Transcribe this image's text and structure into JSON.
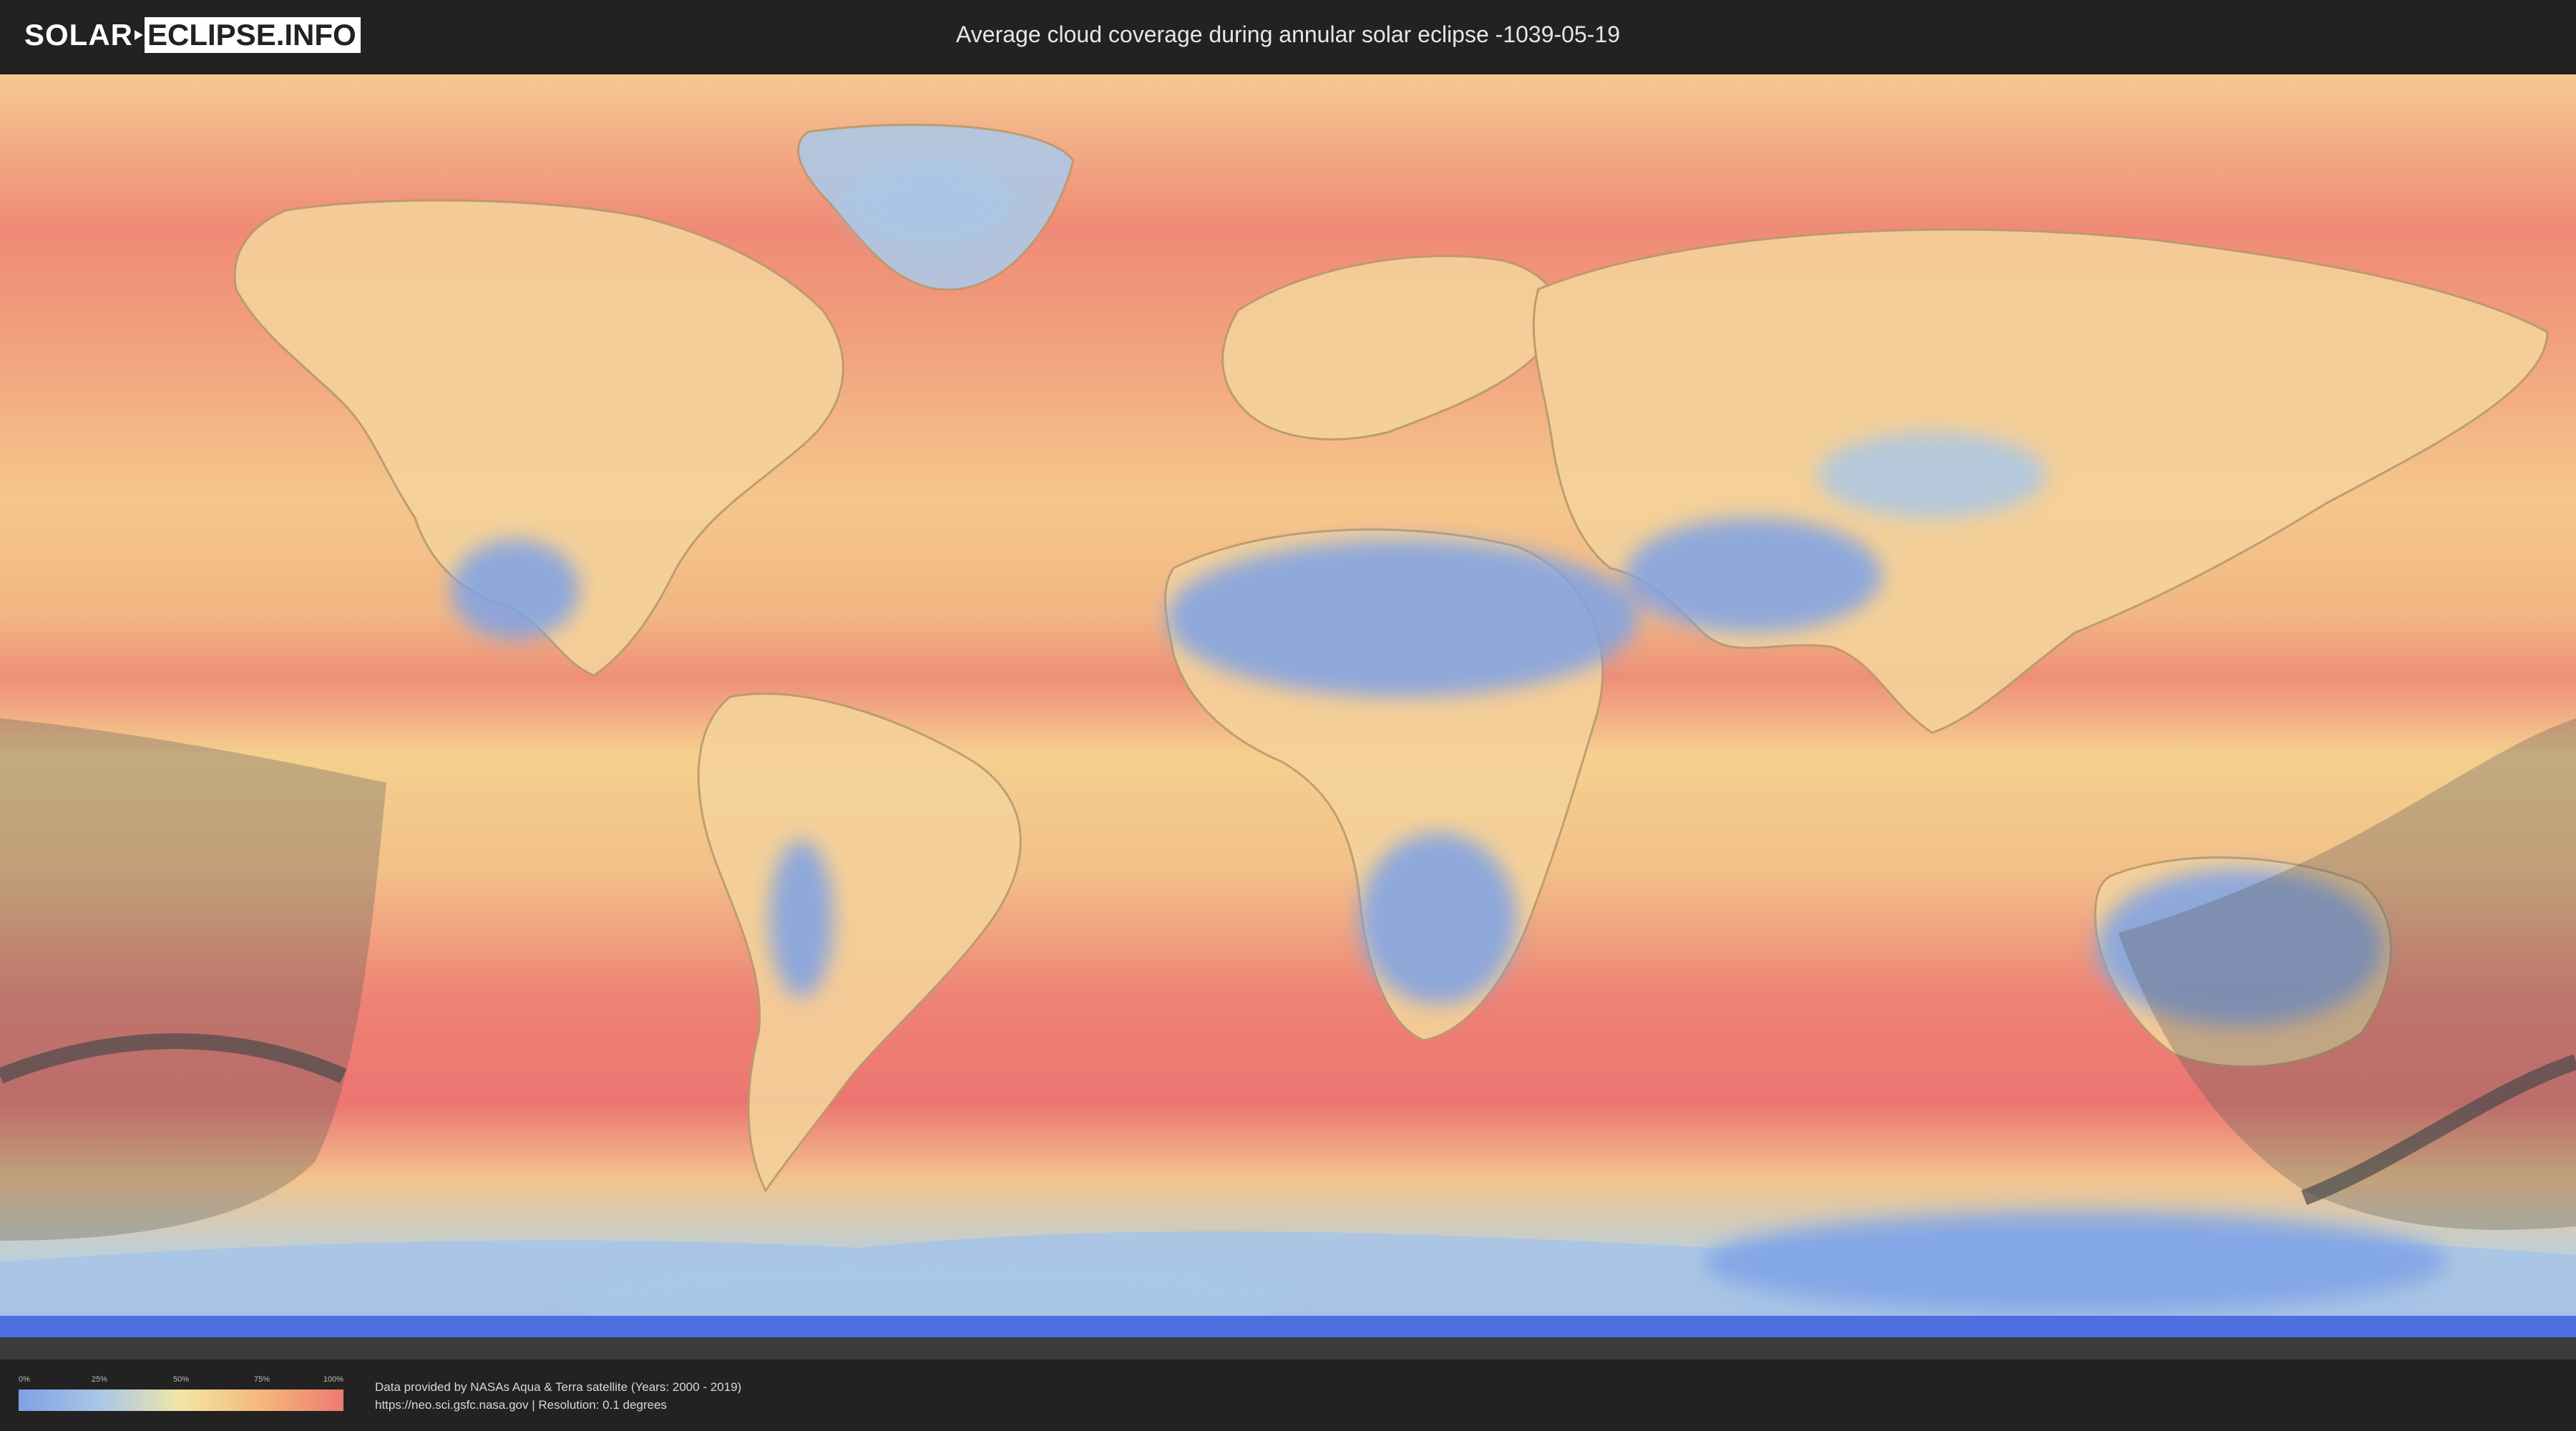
{
  "header": {
    "logo_solar": "SOLAR",
    "logo_eclipse": "ECLIPSE.INFO",
    "title": "Average cloud coverage during annular solar eclipse -1039-05-19"
  },
  "map": {
    "layers": [
      "cloud-coverage-raster",
      "country-borders",
      "eclipse-penumbra-region-west",
      "eclipse-penumbra-region-east",
      "eclipse-central-path"
    ],
    "colors": {
      "clear": "#7fa0e6",
      "low": "#a9c7e6",
      "mid": "#f2e6a6",
      "high": "#f5b77a",
      "overcast": "#ee7a72",
      "eclipse_shadow": "#5a5a5a",
      "polar": "#4e6fe0"
    }
  },
  "legend": {
    "ticks": [
      "0%",
      "25%",
      "50%",
      "75%",
      "100%"
    ]
  },
  "footer": {
    "credit_line1": "Data provided by NASAs Aqua & Terra satellite (Years: 2000 - 2019)",
    "credit_line2": "https://neo.sci.gsfc.nasa.gov | Resolution: 0.1 degrees"
  }
}
